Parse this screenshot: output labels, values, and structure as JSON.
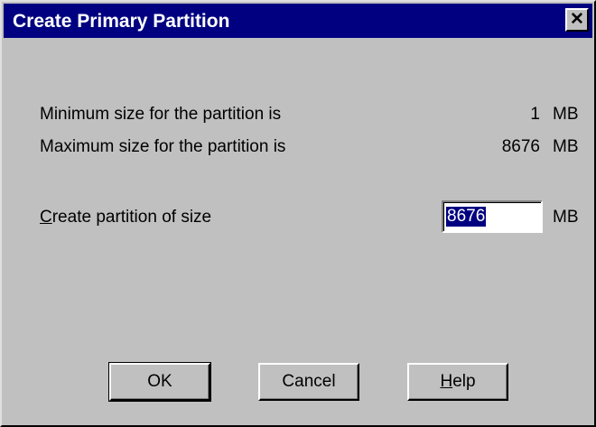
{
  "window": {
    "title": "Create Primary Partition",
    "close_glyph": "✕"
  },
  "info": {
    "min_label": "Minimum size for the partition is",
    "min_value": "1",
    "min_unit": "MB",
    "max_label": "Maximum size for the partition is",
    "max_value": "8676",
    "max_unit": "MB"
  },
  "size_field": {
    "label_mnemonic": "C",
    "label_rest": "reate partition of size",
    "value": "8676",
    "unit": "MB"
  },
  "buttons": {
    "ok": "OK",
    "cancel": "Cancel",
    "help_mnemonic": "H",
    "help_rest": "elp"
  },
  "colors": {
    "title_bar": "#000080",
    "dialog_face": "#c0c0c0",
    "selection": "#000080"
  }
}
